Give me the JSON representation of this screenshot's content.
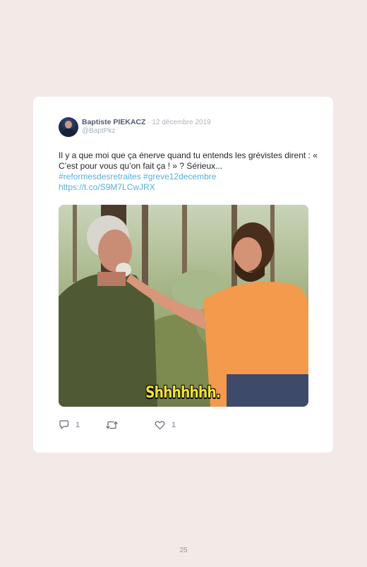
{
  "tweet": {
    "author_name": "Baptiste PIEKACZ",
    "separator": " · ",
    "date": "12 décembre 2019",
    "handle": "@BaptPkz",
    "text": "Il y a que moi que ça énerve quand tu entends les grévistes dirent : « C’est pour vous qu’on fait ça ! » ? Sérieux...",
    "hashtags": "#reformesdesretraites #greve12decembre",
    "url": "https://t.co/S9M7LCwJRX",
    "media_caption": "Shhhhhhh.",
    "actions": {
      "reply_icon": "reply-icon",
      "reply_count": "1",
      "retweet_icon": "retweet-icon",
      "like_icon": "heart-icon",
      "like_count": "1"
    }
  },
  "page": {
    "number": "25"
  },
  "colors": {
    "page_background": "#f3e9e6",
    "card_background": "#ffffff",
    "link": "#55afdc",
    "caption": "#f1e23a"
  }
}
